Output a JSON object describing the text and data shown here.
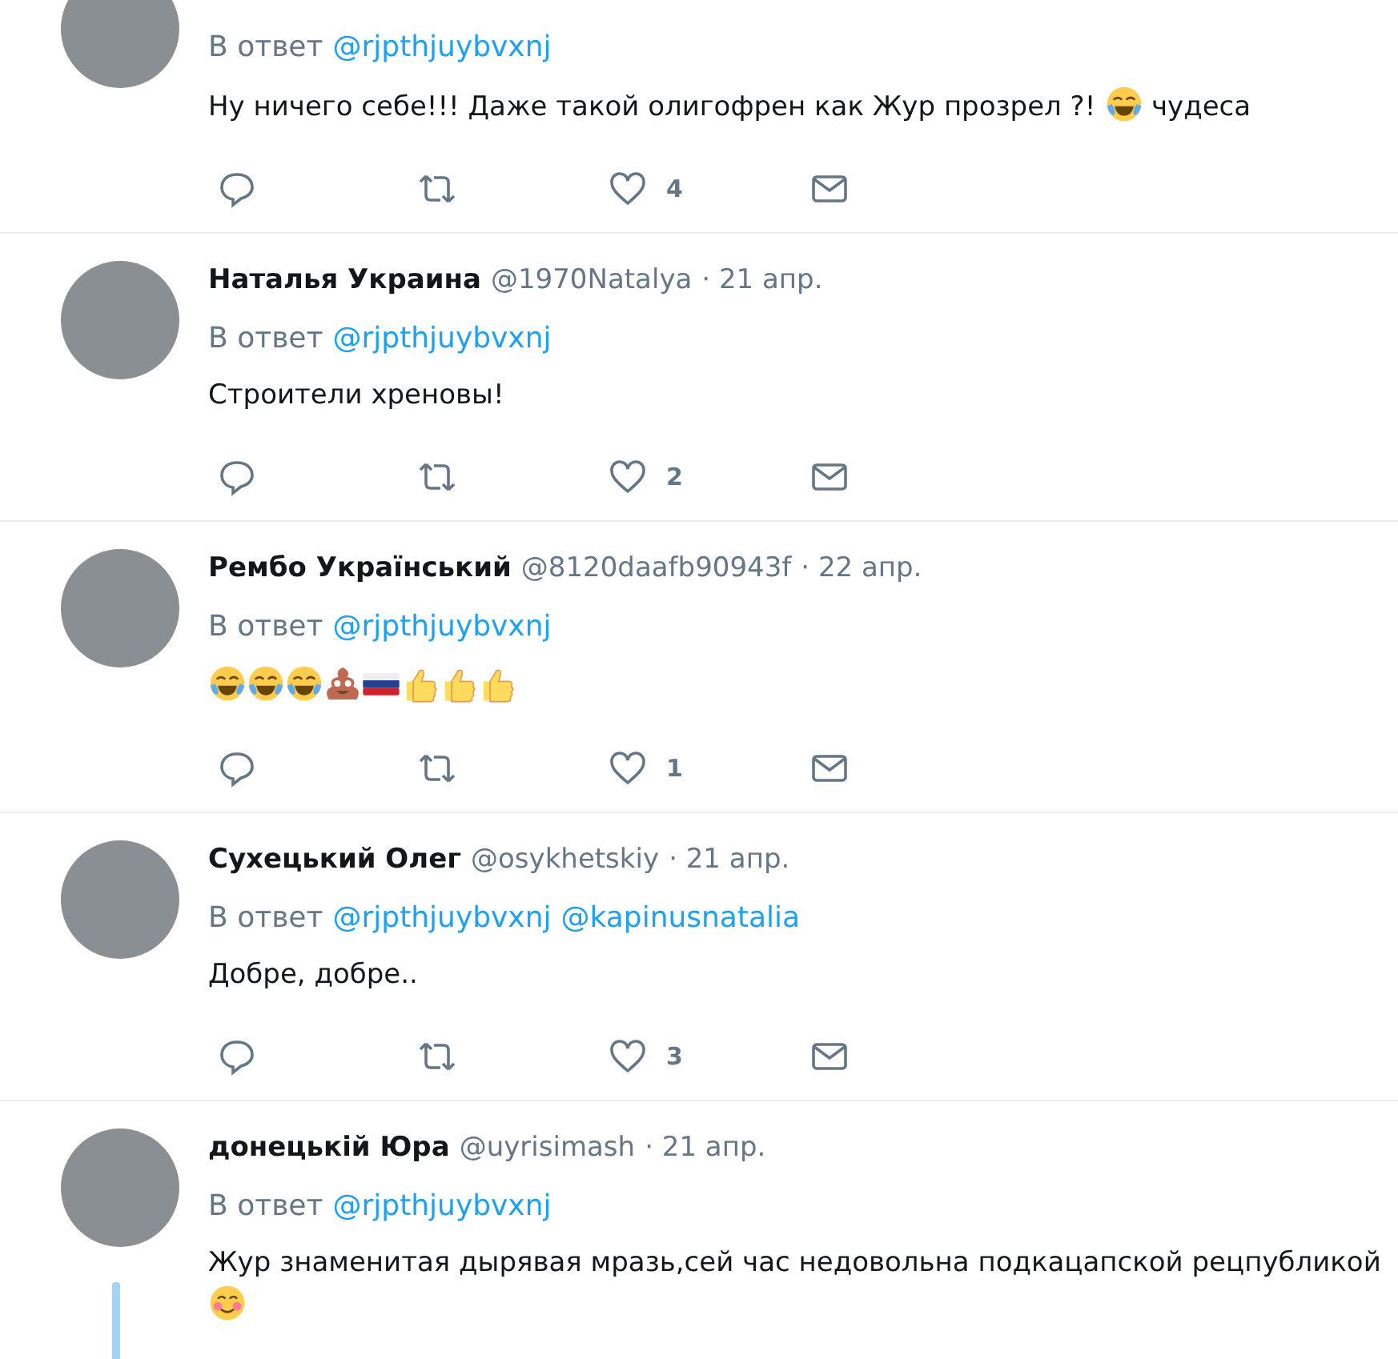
{
  "tweets": [
    {
      "reply_label": "В ответ",
      "reply_to": [
        "@rjpthjuybvxnj"
      ],
      "body": [
        {
          "kind": "text",
          "text": "Ну ничего себе!!! Даже такой олигофрен как Жур прозрел ?! "
        },
        {
          "kind": "laughing"
        },
        {
          "kind": "text",
          "text": " чудеса"
        }
      ],
      "likes": "4",
      "thread": false
    },
    {
      "name": "Наталья Украина",
      "handle": "@1970Natalya",
      "date": "· 21 апр.",
      "reply_label": "В ответ",
      "reply_to": [
        "@rjpthjuybvxnj"
      ],
      "body": [
        {
          "kind": "text",
          "text": "Строители хреновы!"
        }
      ],
      "likes": "2",
      "thread": false
    },
    {
      "name": "Рембо Український",
      "handle": "@8120daafb90943f",
      "date": "· 22 апр.",
      "reply_label": "В ответ",
      "reply_to": [
        "@rjpthjuybvxnj"
      ],
      "body": [
        {
          "kind": "laughing"
        },
        {
          "kind": "laughing"
        },
        {
          "kind": "laughing"
        },
        {
          "kind": "poop"
        },
        {
          "kind": "flag"
        },
        {
          "kind": "thumbsup"
        },
        {
          "kind": "thumbsup"
        },
        {
          "kind": "thumbsup"
        }
      ],
      "likes": "1",
      "thread": false
    },
    {
      "name": "Сухецький Олег",
      "handle": "@osykhetskiy",
      "date": "· 21 апр.",
      "reply_label": "В ответ",
      "reply_to": [
        "@rjpthjuybvxnj",
        "@kapinusnatalia"
      ],
      "body": [
        {
          "kind": "text",
          "text": "Добре, добре.."
        }
      ],
      "likes": "3",
      "thread": false
    },
    {
      "name": "донецькій Юра",
      "handle": "@uyrisimash",
      "date": "· 21 апр.",
      "reply_label": "В ответ",
      "reply_to": [
        "@rjpthjuybvxnj"
      ],
      "body": [
        {
          "kind": "text",
          "text": "Жур знаменитая дырявая мразь,сей час недовольна подкацапской рецпубликой"
        },
        {
          "kind": "blush"
        }
      ],
      "thread": true
    }
  ]
}
